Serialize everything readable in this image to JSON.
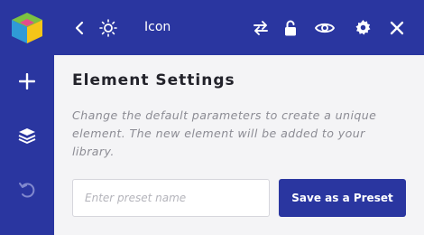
{
  "app": {
    "logo_icon": "cube-logo-icon",
    "colors": {
      "primary": "#2a36a0",
      "panel_bg": "#f4f4f6",
      "logo_green": "#7cc242",
      "logo_blue": "#2f9ad6",
      "logo_yellow": "#f5c518"
    }
  },
  "sidebar": {
    "items": [
      {
        "icon": "plus-icon"
      },
      {
        "icon": "layers-icon"
      },
      {
        "icon": "undo-icon"
      }
    ]
  },
  "header": {
    "title": "Icon",
    "icons": [
      "chevron-left-icon",
      "lightbulb-icon",
      "swap-icon",
      "lock-icon",
      "eye-icon",
      "gear-icon",
      "close-icon"
    ]
  },
  "panel": {
    "heading": "Element Settings",
    "description": "Change the default parameters to create a unique element. The new element will be added to your library.",
    "preset_input": {
      "value": "",
      "placeholder": "Enter preset name"
    },
    "save_label": "Save as a Preset"
  }
}
